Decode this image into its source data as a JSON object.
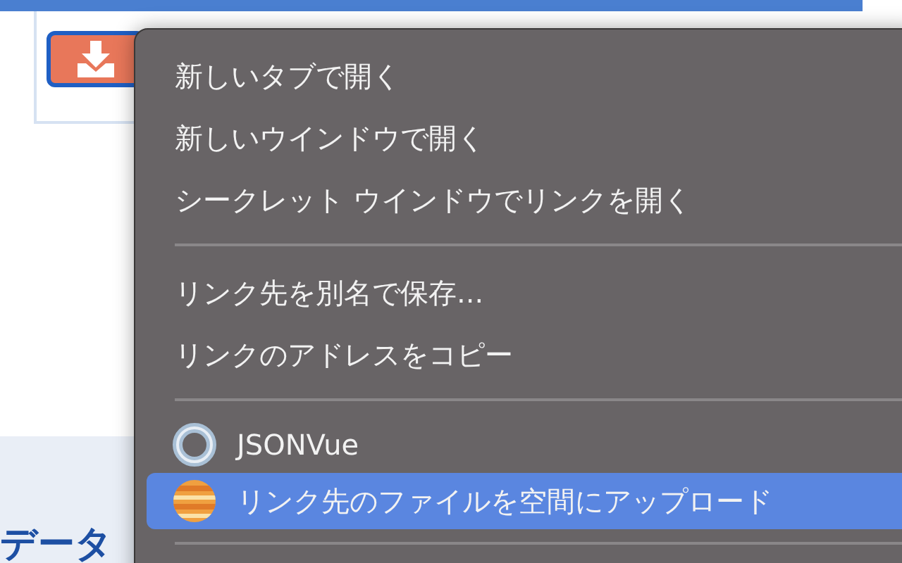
{
  "page": {
    "heading": "データ"
  },
  "context_menu": {
    "items": [
      {
        "kind": "item",
        "label": "新しいタブで開く",
        "selected": false
      },
      {
        "kind": "item",
        "label": "新しいウインドウで開く",
        "selected": false
      },
      {
        "kind": "item",
        "label": "シークレット ウインドウでリンクを開く",
        "selected": false
      },
      {
        "kind": "separator"
      },
      {
        "kind": "item",
        "label": "リンク先を別名で保存...",
        "selected": false
      },
      {
        "kind": "item",
        "label": "リンクのアドレスをコピー",
        "selected": false
      },
      {
        "kind": "separator"
      },
      {
        "kind": "viewer",
        "label": "JSONVue",
        "selected": false
      },
      {
        "kind": "uploader",
        "label": "リンク先のファイルを空間にアップロード",
        "selected": true
      },
      {
        "kind": "separator"
      }
    ]
  }
}
